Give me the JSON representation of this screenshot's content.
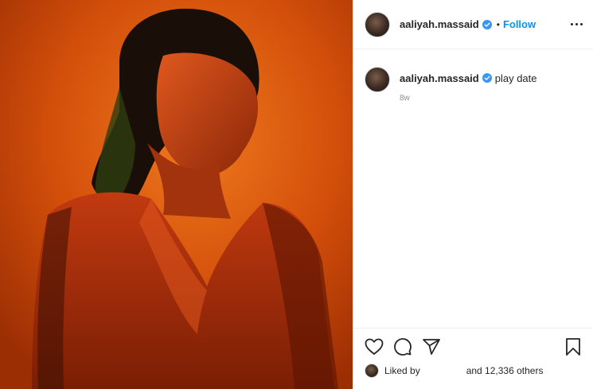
{
  "post": {
    "username": "aaliyah.massaid",
    "follow_label": "Follow",
    "separator": "•",
    "caption": "play date",
    "time_ago": "8w",
    "liked_by_label": "Liked by",
    "likes_suffix": "and 12,336 others",
    "truncated_text": "…"
  },
  "icons": {
    "verified": "verified-badge-icon",
    "more": "more-options-icon",
    "like": "heart-icon",
    "comment": "comment-icon",
    "share": "send-icon",
    "save": "bookmark-icon"
  },
  "colors": {
    "accent": "#0095f6",
    "photo_bg": "#d9520c",
    "text": "#262626",
    "muted": "#8e8e8e"
  }
}
